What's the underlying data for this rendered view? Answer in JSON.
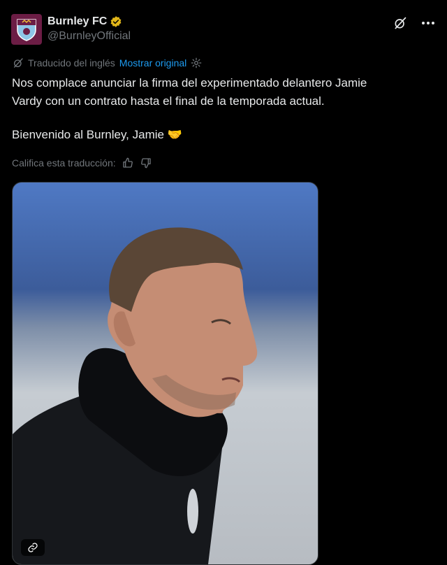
{
  "header": {
    "display_name": "Burnley FC",
    "handle": "@BurnleyOfficial"
  },
  "translation": {
    "notice": "Traducido del inglés",
    "show_original": "Mostrar original"
  },
  "tweet": {
    "line1": "Nos complace anunciar la firma del experimentado delantero Jamie",
    "line2": "Vardy con un contrato hasta el final de la temporada actual.",
    "line3": "Bienvenido al Burnley, Jamie",
    "emoji": "🤝"
  },
  "rating": {
    "label": "Califica esta traducción:"
  },
  "icons": {
    "verified": "verified-badge-icon",
    "grok": "grok-icon",
    "more": "more-icon",
    "translate": "translate-icon",
    "settings": "gear-icon",
    "thumbs_up": "thumbs-up-icon",
    "thumbs_down": "thumbs-down-icon",
    "link": "link-icon"
  },
  "colors": {
    "background": "#000000",
    "text": "#e7e9ea",
    "muted": "#71767b",
    "link": "#1d9bf0",
    "verified": "#e2b719",
    "club": "#6c1d45"
  }
}
